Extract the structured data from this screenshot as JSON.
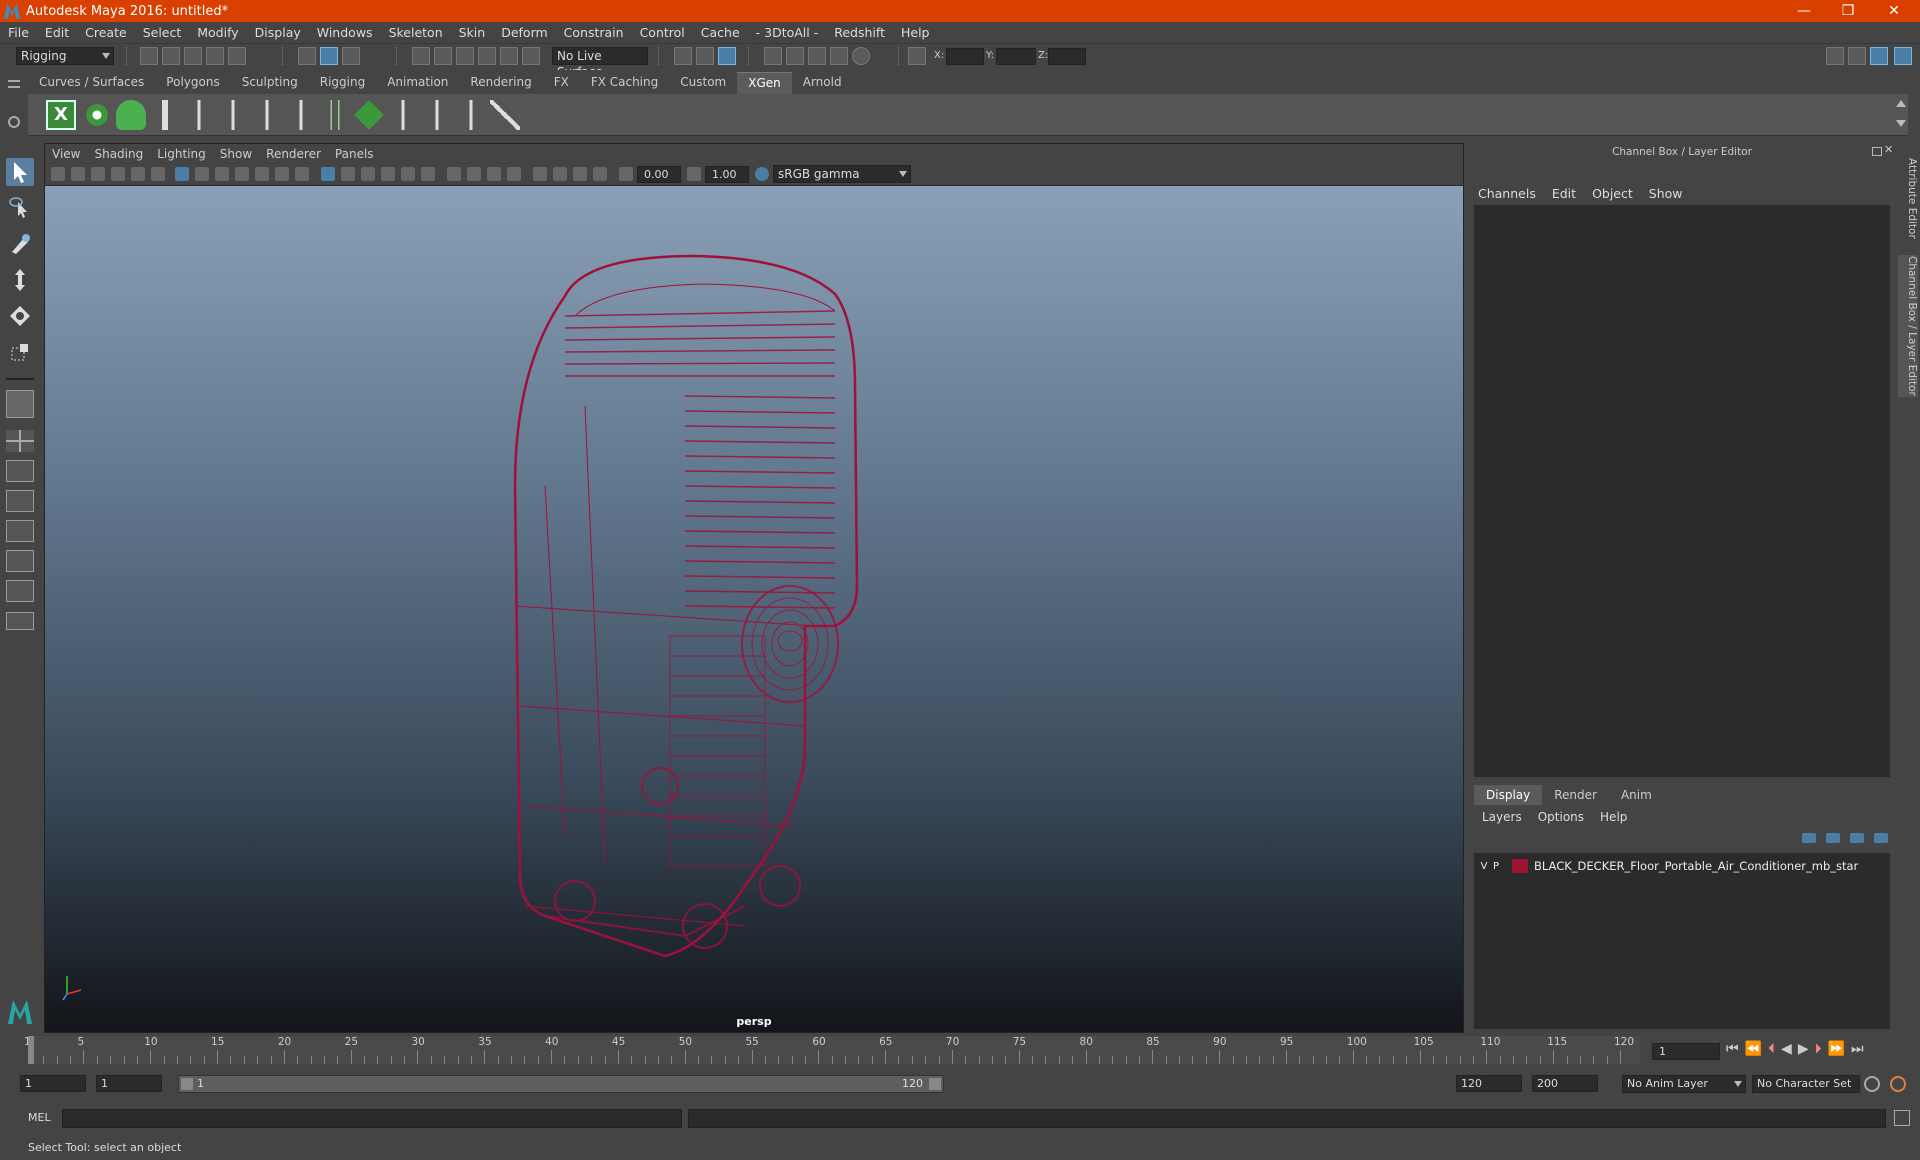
{
  "window": {
    "title": "Autodesk Maya 2016: untitled*",
    "minimize": "—",
    "maximize": "❐",
    "close": "✕"
  },
  "menubar": [
    "File",
    "Edit",
    "Create",
    "Select",
    "Modify",
    "Display",
    "Windows",
    "Skeleton",
    "Skin",
    "Deform",
    "Constrain",
    "Control",
    "Cache",
    "- 3DtoAll -",
    "Redshift",
    "Help"
  ],
  "statusline": {
    "menuset": "Rigging",
    "live_surface": "No Live Surface",
    "x_label": "X:",
    "y_label": "Y:",
    "z_label": "Z:"
  },
  "shelf_tabs": [
    "Curves / Surfaces",
    "Polygons",
    "Sculpting",
    "Rigging",
    "Animation",
    "Rendering",
    "FX",
    "FX Caching",
    "Custom",
    "XGen",
    "Arnold"
  ],
  "shelf_active": "XGen",
  "viewport": {
    "menu": [
      "View",
      "Shading",
      "Lighting",
      "Show",
      "Renderer",
      "Panels"
    ],
    "exposure": "0.00",
    "gamma": "1.00",
    "colorspace": "sRGB gamma",
    "camera": "persp"
  },
  "channel_box": {
    "header": "Channel Box / Layer Editor",
    "menu": [
      "Channels",
      "Edit",
      "Object",
      "Show"
    ]
  },
  "layer_editor": {
    "tabs": [
      "Display",
      "Render",
      "Anim"
    ],
    "active_tab": "Display",
    "menu": [
      "Layers",
      "Options",
      "Help"
    ],
    "layers": [
      {
        "v": "V",
        "p": "P",
        "name": "BLACK_DECKER_Floor_Portable_Air_Conditioner_mb_star",
        "color": "#9e1434"
      }
    ]
  },
  "side_tabs": {
    "attribute_editor": "Attribute Editor",
    "channel_box": "Channel Box / Layer Editor"
  },
  "timeline": {
    "ticks": [
      1,
      5,
      10,
      15,
      20,
      25,
      30,
      35,
      40,
      45,
      50,
      55,
      60,
      65,
      70,
      75,
      80,
      85,
      90,
      95,
      100,
      105,
      110,
      115,
      120
    ],
    "current_frame": "1"
  },
  "range": {
    "start": "1",
    "playback_start": "1",
    "slider_start": "1",
    "slider_end": "120",
    "playback_end": "120",
    "end": "200",
    "anim_layer": "No Anim Layer",
    "char_set": "No Character Set"
  },
  "cmdline": {
    "label": "MEL"
  },
  "helpline": {
    "text": "Select Tool: select an object"
  },
  "colors": {
    "wire": "#a0103a",
    "accent": "#d94000"
  }
}
